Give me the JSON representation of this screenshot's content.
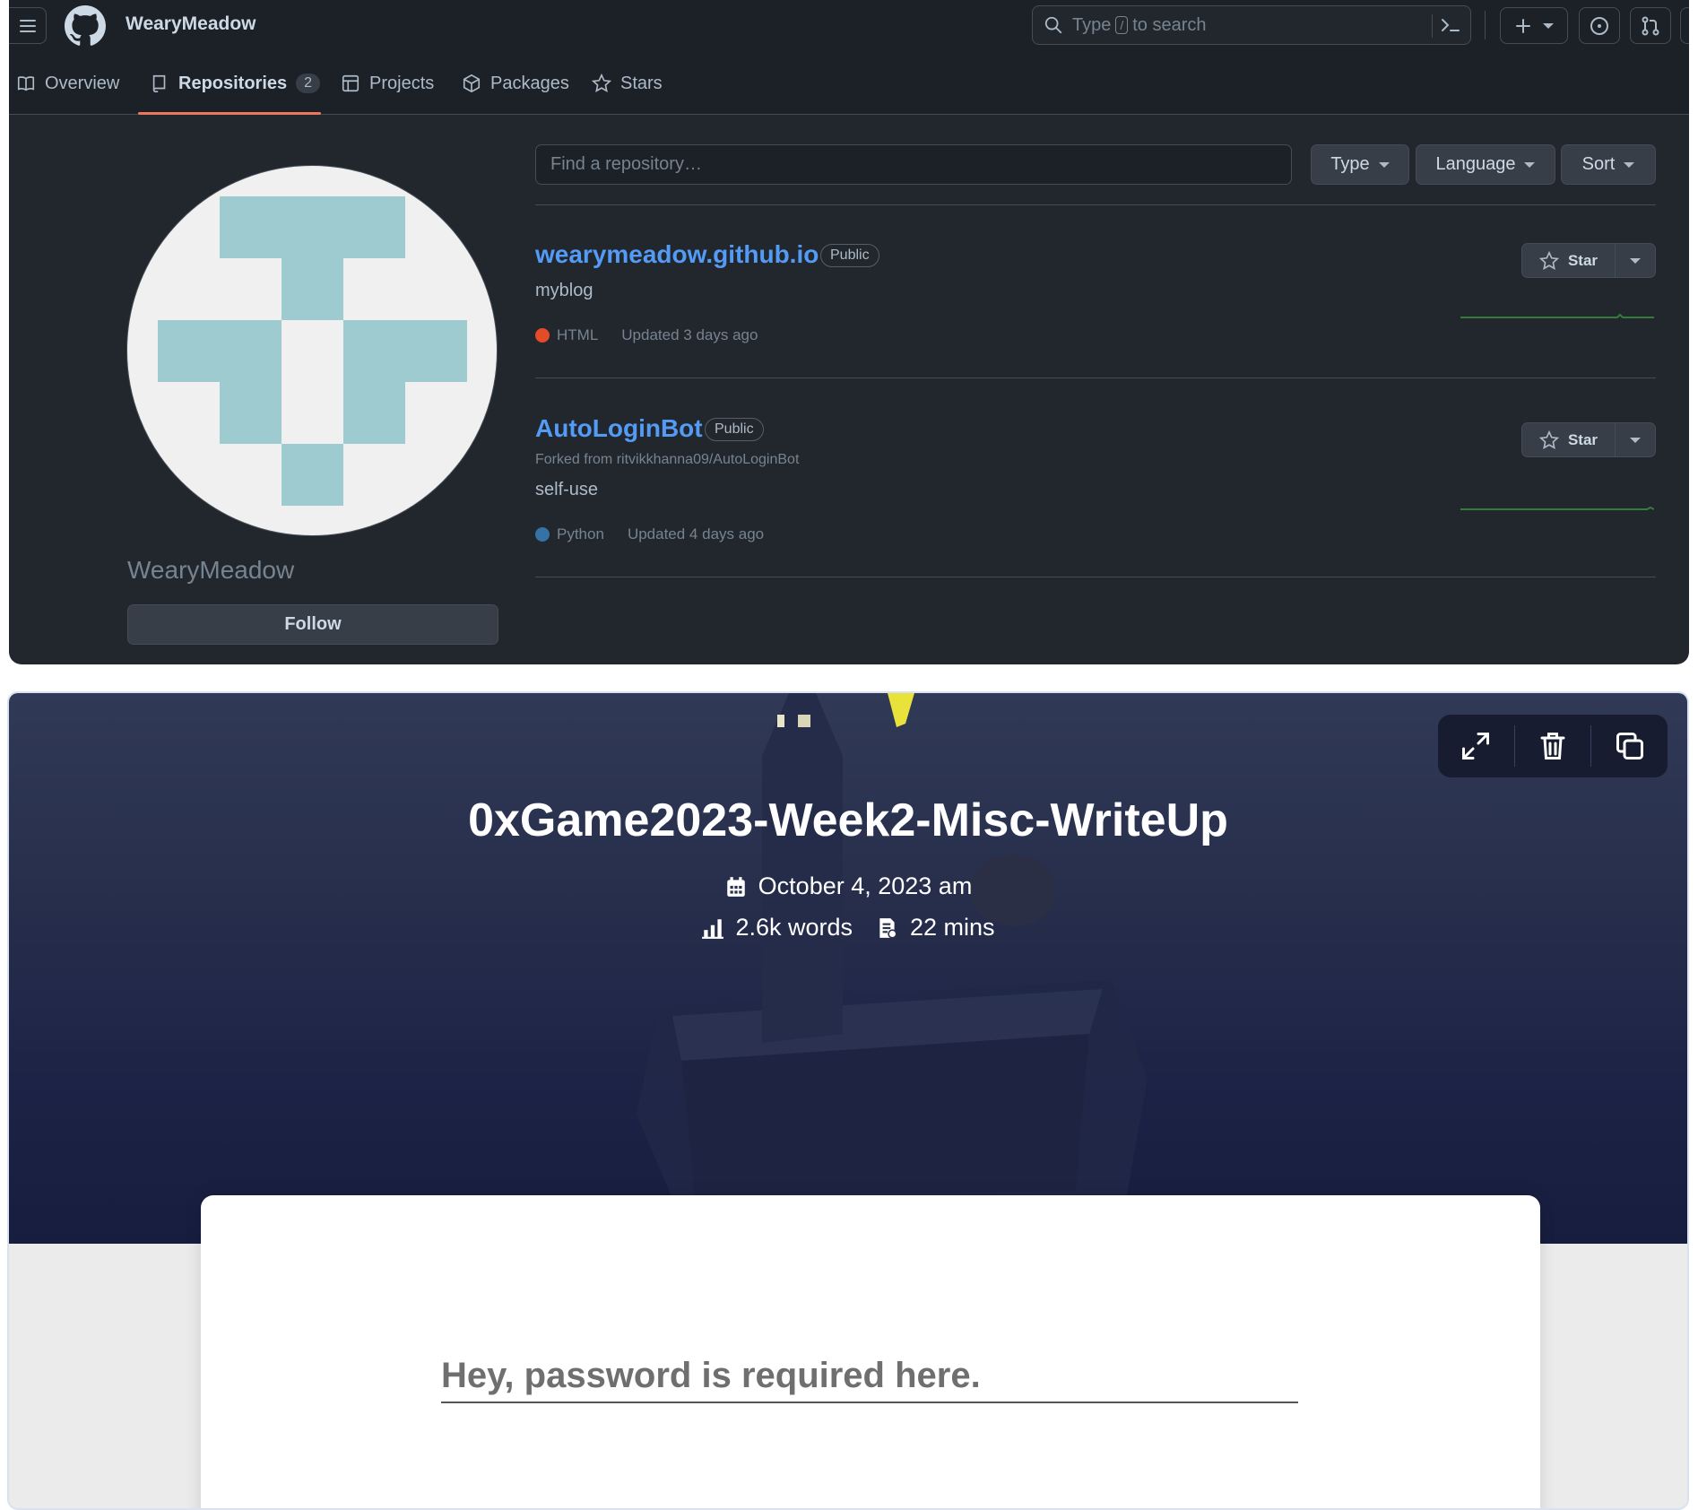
{
  "github": {
    "username": "WearyMeadow",
    "search": {
      "prefix": "Type",
      "key": "/",
      "suffix": "to search"
    },
    "tabs": [
      {
        "label": "Overview",
        "icon": "book-icon"
      },
      {
        "label": "Repositories",
        "icon": "repo-icon",
        "count": "2",
        "active": true
      },
      {
        "label": "Projects",
        "icon": "table-icon"
      },
      {
        "label": "Packages",
        "icon": "package-icon"
      },
      {
        "label": "Stars",
        "icon": "star-icon"
      }
    ],
    "profile": {
      "name": "WearyMeadow",
      "follow_label": "Follow"
    },
    "filters": {
      "find_placeholder": "Find a repository…",
      "type_label": "Type",
      "language_label": "Language",
      "sort_label": "Sort"
    },
    "repos": [
      {
        "name": "wearymeadow.github.io",
        "visibility": "Public",
        "description": "myblog",
        "language": "HTML",
        "language_color": "#e34c26",
        "updated": "Updated 3 days ago",
        "star_label": "Star"
      },
      {
        "name": "AutoLoginBot",
        "visibility": "Public",
        "forked_from": "Forked from ritvikkhanna09/AutoLoginBot",
        "description": "self-use",
        "language": "Python",
        "language_color": "#3572a5",
        "updated": "Updated 4 days ago",
        "star_label": "Star"
      }
    ],
    "colors": {
      "accent_underline": "#ec775c",
      "link": "#539bf5",
      "bg": "#22272e"
    }
  },
  "blog": {
    "toolbar": [
      "expand-icon",
      "trash-icon",
      "copy-icon"
    ],
    "title": "0xGame2023-Week2-Misc-WriteUp",
    "date": "October 4, 2023 am",
    "words": "2.6k words",
    "read_time": "22 mins",
    "password_placeholder": "Hey, password is required here."
  }
}
